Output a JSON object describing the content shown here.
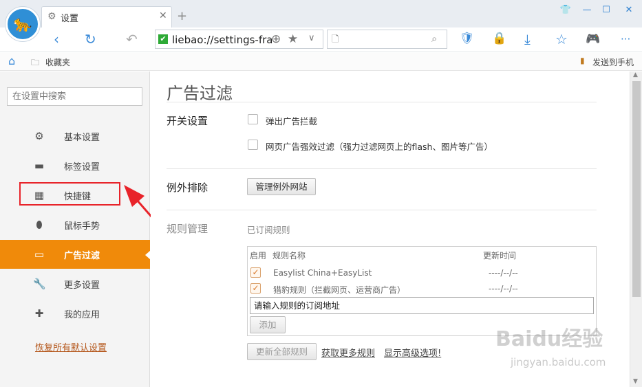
{
  "window": {
    "tab_title": "设置",
    "address": "liebao://settings-fra",
    "secure_mark": "✔"
  },
  "bookmarks": {
    "favorites_label": "收藏夹",
    "send_to_phone": "发送到手机"
  },
  "sidebar": {
    "search_placeholder": "在设置中搜索",
    "items": [
      {
        "label": "基本设置",
        "icon": "gear-icon"
      },
      {
        "label": "标签设置",
        "icon": "tab-icon"
      },
      {
        "label": "快捷键",
        "icon": "shortcut-icon"
      },
      {
        "label": "鼠标手势",
        "icon": "mouse-icon"
      },
      {
        "label": "广告过滤",
        "icon": "window-icon",
        "active": true
      },
      {
        "label": "更多设置",
        "icon": "wrench-icon"
      },
      {
        "label": "我的应用",
        "icon": "puzzle-icon"
      }
    ],
    "restore_link": "恢复所有默认设置"
  },
  "main": {
    "title": "广告过滤",
    "switch_section": {
      "label": "开关设置",
      "options": [
        {
          "label": "弹出广告拦截",
          "checked": false
        },
        {
          "label": "网页广告强效过滤（强力过滤网页上的flash、图片等广告）",
          "checked": false
        }
      ]
    },
    "exception_section": {
      "label": "例外排除",
      "button": "管理例外网站"
    },
    "rules_section": {
      "label": "规则管理",
      "subscribed_label": "已订阅规则",
      "headers": {
        "enabled": "启用",
        "name": "规则名称",
        "updated": "更新时间"
      },
      "rules": [
        {
          "name": "Easylist China+EasyList",
          "updated": "----/--/--",
          "enabled": true
        },
        {
          "name": "猎豹规则（拦截网页、运营商广告）",
          "updated": "----/--/--",
          "enabled": true
        }
      ],
      "input_value": "请输入规则的订阅地址",
      "add_button": "添加",
      "update_all_button": "更新全部规则",
      "more_rules_link": "获取更多规则",
      "advanced_link": "显示高级选项!"
    }
  },
  "watermark": {
    "text": "Baidu经验",
    "sub": "jingyan.baidu.com"
  },
  "colors": {
    "accent": "#f08a0a",
    "highlight_box": "#e8232a",
    "icon_blue": "#3a8ad8"
  }
}
